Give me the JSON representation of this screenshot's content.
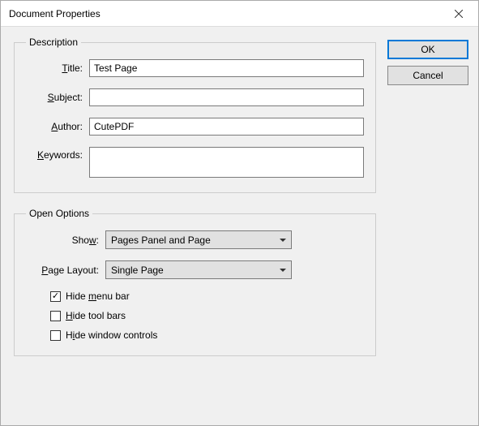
{
  "window": {
    "title": "Document Properties"
  },
  "buttons": {
    "ok": "OK",
    "cancel": "Cancel"
  },
  "description": {
    "legend": "Description",
    "title_label": "Title:",
    "title_value": "Test Page",
    "subject_label": "Subject:",
    "subject_value": "",
    "author_label": "Author:",
    "author_value": "CutePDF",
    "keywords_label": "Keywords:",
    "keywords_value": ""
  },
  "open_options": {
    "legend": "Open Options",
    "show_label": "Show:",
    "show_value": "Pages Panel and Page",
    "page_layout_label": "Page Layout:",
    "page_layout_value": "Single Page",
    "hide_menu_bar_label": "Hide menu bar",
    "hide_menu_bar_checked": true,
    "hide_tool_bars_label": "Hide tool bars",
    "hide_tool_bars_checked": false,
    "hide_window_controls_label": "Hide window controls",
    "hide_window_controls_checked": false
  }
}
